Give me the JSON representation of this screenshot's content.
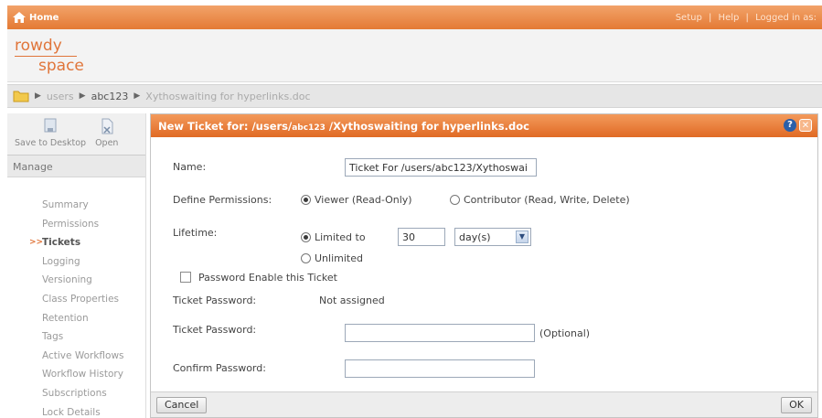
{
  "topbar": {
    "home_label": "Home",
    "links": [
      "Setup",
      "|",
      "Help",
      "|",
      "Logged in as:"
    ]
  },
  "logo": {
    "line1": "rowdy",
    "line2": "space"
  },
  "breadcrumb": {
    "segments": [
      "users",
      "abc123",
      "Xythoswaiting for hyperlinks.doc"
    ]
  },
  "sidebar": {
    "toolbar": {
      "save_label": "Save to Desktop",
      "open_label": "Open"
    },
    "manage_label": "Manage",
    "items": [
      "Summary",
      "Permissions",
      "Tickets",
      "Logging",
      "Versioning",
      "Class Properties",
      "Retention",
      "Tags",
      "Active Workflows",
      "Workflow History",
      "Subscriptions",
      "Lock Details"
    ],
    "active_item": "Tickets"
  },
  "dialog": {
    "title_prefix": "New Ticket for: /users/",
    "title_user": "abc123",
    "title_suffix": " /Xythoswaiting for hyperlinks.doc",
    "name_label": "Name:",
    "name_value": "Ticket For /users/abc123/Xythoswai",
    "permissions_label": "Define Permissions:",
    "viewer_label": "Viewer (Read-Only)",
    "contributor_label": "Contributor (Read, Write, Delete)",
    "lifetime_label": "Lifetime:",
    "limited_label": "Limited to",
    "limited_value": "30",
    "unit_value": "day(s)",
    "unlimited_label": "Unlimited",
    "password_enable_label": "Password Enable this Ticket",
    "ticket_password_label": "Ticket Password:",
    "ticket_password_status": "Not assigned",
    "ticket_password_label2": "Ticket Password:",
    "optional_label": "(Optional)",
    "confirm_password_label": "Confirm Password:",
    "cancel_label": "Cancel",
    "ok_label": "OK"
  },
  "colors": {
    "accent": "#e47a34",
    "logo": "#e0753a"
  }
}
